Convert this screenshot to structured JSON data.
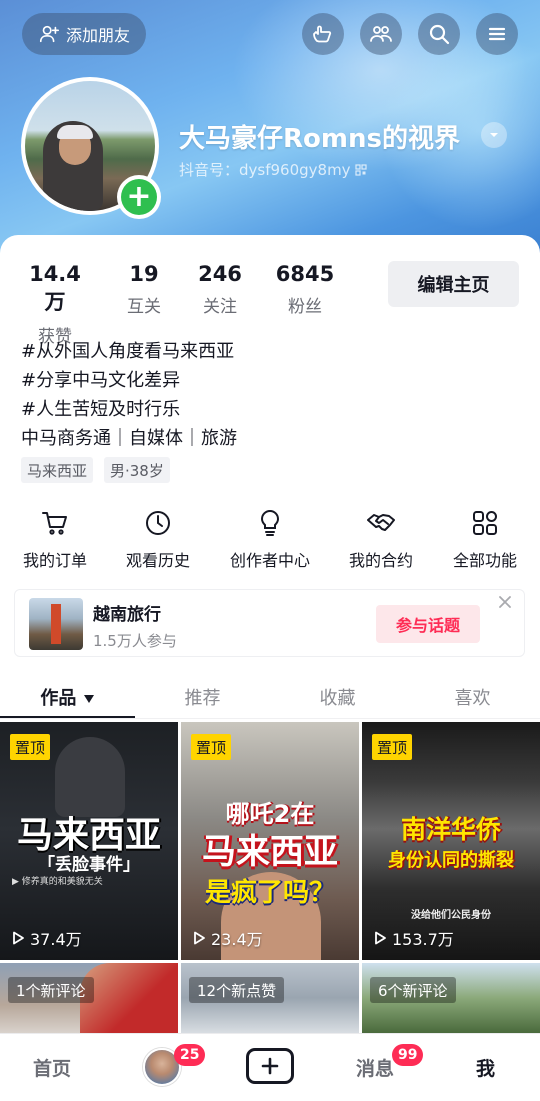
{
  "header": {
    "add_friend_label": "添加朋友",
    "nickname": "大马豪仔Romns的视界",
    "douyin_id": "抖音号：dysf960gy8my",
    "top_icons": [
      "hand-icon",
      "friends-icon",
      "search-icon",
      "menu-icon"
    ]
  },
  "stats": [
    {
      "num": "14.4万",
      "label": "获赞"
    },
    {
      "num": "19",
      "label": "互关"
    },
    {
      "num": "246",
      "label": "关注"
    },
    {
      "num": "6845",
      "label": "粉丝"
    }
  ],
  "edit_button": "编辑主页",
  "bio": [
    "#从外国人角度看马来西亚",
    "#分享中马文化差异",
    "#人生苦短及时行乐",
    "中马商务通｜自媒体｜旅游"
  ],
  "tags": [
    "马来西亚",
    "男·38岁"
  ],
  "functions": [
    {
      "icon": "cart-icon",
      "label": "我的订单"
    },
    {
      "icon": "clock-icon",
      "label": "观看历史"
    },
    {
      "icon": "bulb-icon",
      "label": "创作者中心"
    },
    {
      "icon": "handshake-icon",
      "label": "我的合约"
    },
    {
      "icon": "grid-icon",
      "label": "全部功能"
    }
  ],
  "topic": {
    "title": "越南旅行",
    "participants": "1.5万人参与",
    "join_label": "参与话题"
  },
  "tabs": [
    "作品",
    "推荐",
    "收藏",
    "喜欢"
  ],
  "videos": [
    {
      "pinned": "置顶",
      "line1": "马来西亚",
      "line2": "「丢脸事件」",
      "caption": "修养真的和美貌无关",
      "views": "37.4万"
    },
    {
      "pinned": "置顶",
      "line0": "哪吒2在",
      "line1": "马来西亚",
      "line2": "是疯了吗？",
      "views": "23.4万"
    },
    {
      "pinned": "置顶",
      "line1": "南洋华侨",
      "line2": "身份认同的撕裂",
      "caption": "没给他们公民身份",
      "views": "153.7万"
    },
    {
      "note": "1个新评论"
    },
    {
      "note": "12个新点赞"
    },
    {
      "note": "6个新评论"
    }
  ],
  "bottom_nav": {
    "home": "首页",
    "friends_badge": "25",
    "messages": "消息",
    "messages_badge": "99",
    "me": "我"
  }
}
